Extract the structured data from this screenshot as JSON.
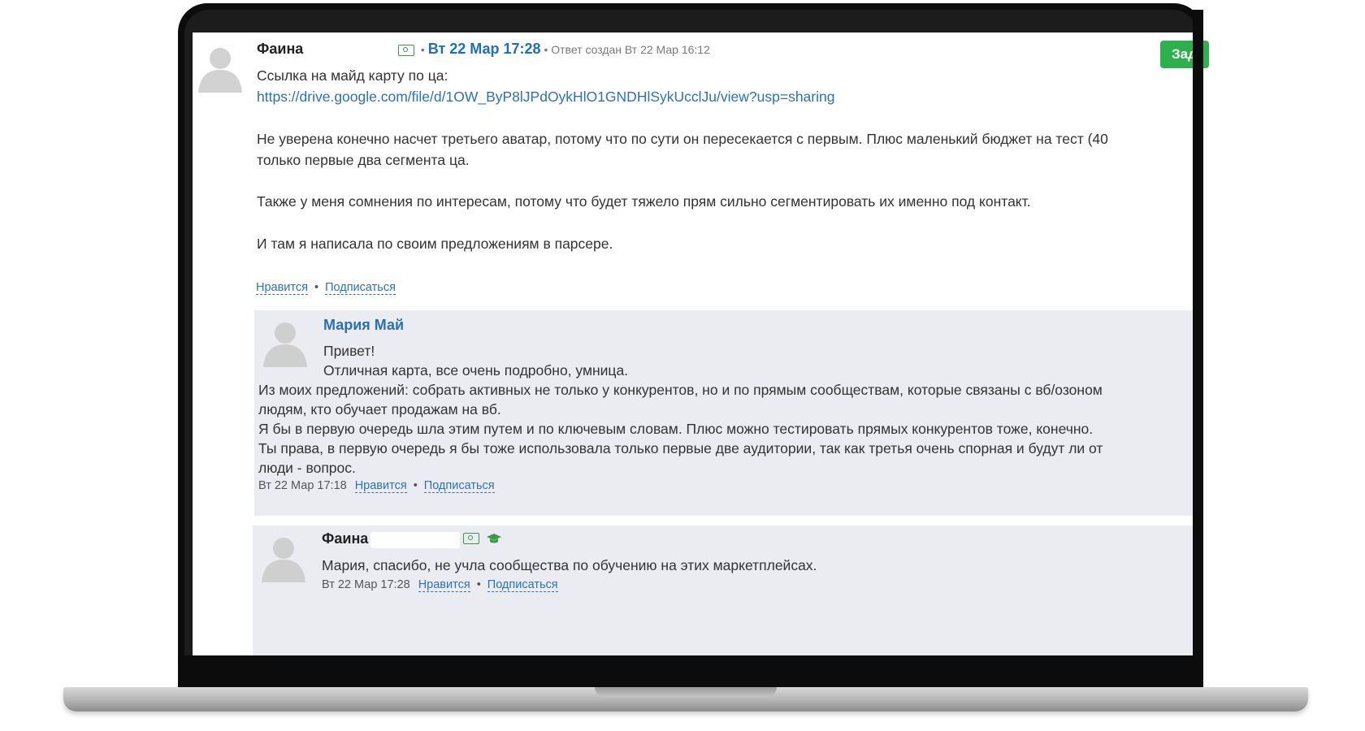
{
  "post": {
    "author": "Фаина",
    "date": "Вт 22 Мар 17:28",
    "created": "Ответ создан Вт 22 Мар 16:12",
    "action_button": "Зад",
    "lines": [
      "Ссылка на майд карту по ца:",
      "https://drive.google.com/file/d/1OW_ByP8lJPdOykHlO1GNDHlSykUcclJu/view?usp=sharing",
      "Не уверена конечно насчет третьего аватар, потому что по сути он пересекается с первым. Плюс маленький бюджет на тест (40",
      "только первые два сегмента ца.",
      "Также у меня сомнения по интересам, потому что будет тяжело прям сильно сегментировать их именно под контакт.",
      "И там я написала по своим предложениям в парсере."
    ],
    "like": "Нравится",
    "subscribe": "Подписаться"
  },
  "reply1": {
    "author": "Мария Май",
    "lines": [
      "Привет!",
      "Отличная карта, все очень подробно, умница.",
      "Из моих предложений: собрать активных не только у конкурентов, но и по прямым сообществам, которые связаны с вб/озоном",
      "людям, кто обучает продажам на вб.",
      "Я бы в первую очередь шла этим путем и по ключевым словам. Плюс можно тестировать прямых конкурентов тоже, конечно.",
      "Ты права, в первую очередь я бы тоже использовала только первые две аудитории, так как третья очень спорная и будут ли от",
      "люди - вопрос."
    ],
    "time": "Вт 22 Мар 17:18",
    "like": "Нравится",
    "subscribe": "Подписаться"
  },
  "reply2": {
    "author": "Фаина",
    "lines": [
      "Мария, спасибо, не учла сообщества по обучению на этих маркетплейсах."
    ],
    "time": "Вт 22 Мар 17:28",
    "like": "Нравится",
    "subscribe": "Подписаться"
  },
  "colors": {
    "link": "#2d72b8",
    "green_button": "#2eb04f",
    "reply_background": "#eaecf1"
  },
  "icons": [
    "money-icon",
    "graduation-cap-icon",
    "user-avatar-placeholder"
  ]
}
